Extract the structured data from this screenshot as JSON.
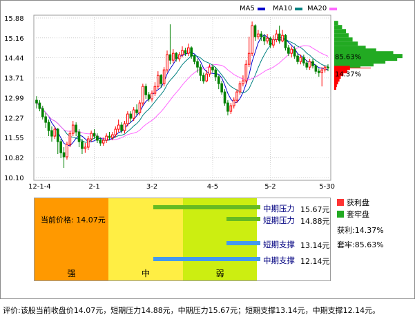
{
  "chart_data": {
    "type": "candlestick",
    "legend": [
      "MA5",
      "MA10",
      "MA20"
    ],
    "colors": {
      "up": "#ff0000",
      "down": "#008000",
      "ma5": "#0000cc",
      "ma10": "#008080",
      "ma20": "#ff66ff",
      "profit": "#ff0000",
      "locked": "#22aa22"
    },
    "y_ticks": [
      "15.88",
      "15.16",
      "14.44",
      "13.71",
      "12.99",
      "12.27",
      "11.55",
      "10.82",
      "10.10"
    ],
    "ylim": [
      10.1,
      15.88
    ],
    "x_ticks": [
      "12-1-4",
      "2-1",
      "3-2",
      "4-5",
      "5-2",
      "5-30"
    ],
    "grid": true,
    "candles": [
      [
        12.9,
        12.8,
        13.05,
        12.6
      ],
      [
        12.8,
        12.6,
        12.9,
        12.5
      ],
      [
        12.6,
        12.3,
        12.7,
        12.2
      ],
      [
        12.3,
        12.1,
        12.45,
        11.9
      ],
      [
        12.1,
        11.8,
        12.2,
        11.6
      ],
      [
        11.8,
        11.6,
        11.95,
        11.4
      ],
      [
        11.6,
        11.85,
        11.95,
        11.5
      ],
      [
        11.85,
        11.4,
        11.9,
        10.95
      ],
      [
        11.4,
        11.0,
        11.5,
        10.8
      ],
      [
        11.0,
        10.85,
        11.2,
        10.45
      ],
      [
        10.85,
        11.3,
        11.4,
        10.75
      ],
      [
        11.3,
        11.7,
        11.8,
        11.2
      ],
      [
        11.7,
        12.0,
        12.15,
        11.6
      ],
      [
        12.0,
        11.75,
        12.1,
        11.6
      ],
      [
        11.75,
        11.4,
        11.85,
        11.2
      ],
      [
        11.4,
        11.15,
        11.5,
        10.95
      ],
      [
        11.15,
        11.2,
        11.35,
        11.0
      ],
      [
        11.2,
        11.5,
        11.6,
        11.1
      ],
      [
        11.5,
        11.7,
        11.8,
        11.4
      ],
      [
        11.7,
        11.6,
        11.85,
        11.5
      ],
      [
        11.6,
        11.45,
        11.7,
        11.35
      ],
      [
        11.45,
        11.35,
        11.55,
        11.25
      ],
      [
        11.35,
        11.45,
        11.55,
        11.25
      ],
      [
        11.45,
        11.6,
        11.7,
        11.35
      ],
      [
        11.6,
        11.55,
        11.75,
        11.45
      ],
      [
        11.55,
        11.65,
        11.75,
        11.45
      ],
      [
        11.65,
        11.85,
        11.95,
        11.55
      ],
      [
        11.85,
        12.0,
        12.2,
        11.75
      ],
      [
        12.0,
        11.8,
        12.1,
        11.7
      ],
      [
        11.8,
        12.05,
        12.15,
        11.7
      ],
      [
        12.05,
        12.4,
        12.5,
        11.95
      ],
      [
        12.4,
        12.25,
        12.5,
        12.1
      ],
      [
        12.25,
        12.55,
        12.65,
        12.15
      ],
      [
        12.55,
        12.45,
        12.75,
        12.35
      ],
      [
        12.45,
        12.8,
        12.9,
        12.35
      ],
      [
        12.8,
        13.4,
        13.5,
        12.7
      ],
      [
        13.4,
        13.1,
        13.5,
        12.95
      ],
      [
        13.1,
        12.95,
        13.2,
        12.85
      ],
      [
        12.95,
        13.15,
        13.25,
        12.85
      ],
      [
        13.15,
        13.4,
        13.55,
        13.05
      ],
      [
        13.4,
        13.8,
        13.95,
        13.3
      ],
      [
        13.8,
        13.5,
        13.85,
        13.35
      ],
      [
        13.5,
        14.0,
        14.1,
        13.4
      ],
      [
        14.0,
        14.55,
        14.7,
        13.9
      ],
      [
        14.55,
        14.35,
        15.65,
        14.2
      ],
      [
        14.35,
        14.6,
        14.75,
        14.25
      ],
      [
        14.6,
        14.4,
        14.65,
        14.3
      ],
      [
        14.4,
        14.55,
        14.65,
        14.3
      ],
      [
        14.55,
        14.7,
        14.85,
        14.45
      ],
      [
        14.7,
        14.6,
        14.8,
        14.5
      ],
      [
        14.6,
        14.8,
        14.95,
        14.5
      ],
      [
        14.8,
        14.5,
        14.85,
        14.4
      ],
      [
        14.5,
        14.3,
        14.55,
        14.2
      ],
      [
        14.3,
        14.1,
        14.4,
        13.9
      ],
      [
        14.1,
        13.8,
        14.2,
        13.6
      ],
      [
        13.8,
        13.6,
        13.9,
        13.5
      ],
      [
        13.6,
        13.85,
        14.0,
        13.55
      ],
      [
        13.85,
        14.1,
        14.2,
        13.75
      ],
      [
        14.1,
        14.0,
        14.2,
        13.9
      ],
      [
        14.0,
        13.75,
        14.1,
        13.6
      ],
      [
        13.75,
        13.5,
        13.8,
        13.3
      ],
      [
        13.5,
        13.2,
        13.6,
        13.1
      ],
      [
        13.2,
        12.8,
        13.3,
        12.7
      ],
      [
        12.8,
        12.5,
        12.9,
        12.35
      ],
      [
        12.5,
        12.7,
        12.8,
        12.4
      ],
      [
        12.7,
        12.9,
        13.0,
        12.6
      ],
      [
        12.9,
        13.2,
        13.3,
        12.8
      ],
      [
        13.2,
        13.5,
        13.6,
        13.1
      ],
      [
        13.5,
        13.6,
        13.8,
        13.4
      ],
      [
        13.6,
        14.2,
        14.35,
        13.5
      ],
      [
        14.2,
        14.6,
        15.2,
        14.1
      ],
      [
        14.6,
        15.6,
        15.75,
        14.5
      ],
      [
        15.6,
        15.2,
        15.65,
        15.05
      ],
      [
        15.2,
        15.3,
        15.45,
        15.1
      ],
      [
        15.3,
        15.2,
        15.4,
        15.05
      ],
      [
        15.2,
        15.05,
        15.3,
        14.9
      ],
      [
        15.05,
        15.15,
        15.3,
        14.95
      ],
      [
        15.15,
        14.9,
        15.2,
        14.8
      ],
      [
        14.9,
        15.1,
        15.25,
        14.8
      ],
      [
        15.1,
        15.3,
        15.45,
        15.0
      ],
      [
        15.3,
        15.05,
        15.6,
        14.95
      ],
      [
        15.05,
        15.25,
        15.45,
        15.0
      ],
      [
        15.25,
        14.8,
        15.3,
        14.7
      ],
      [
        14.8,
        14.6,
        14.9,
        14.5
      ],
      [
        14.6,
        14.75,
        14.85,
        14.45
      ],
      [
        14.75,
        14.5,
        14.85,
        14.4
      ],
      [
        14.5,
        14.3,
        14.6,
        14.2
      ],
      [
        14.3,
        14.45,
        14.55,
        14.2
      ],
      [
        14.45,
        14.25,
        14.55,
        14.15
      ],
      [
        14.25,
        14.1,
        14.35,
        14.0
      ],
      [
        14.1,
        14.3,
        14.4,
        14.0
      ],
      [
        14.3,
        14.15,
        14.4,
        14.05
      ],
      [
        14.15,
        13.95,
        14.2,
        13.85
      ],
      [
        13.95,
        13.9,
        14.05,
        13.75
      ],
      [
        13.9,
        14.0,
        14.1,
        13.4
      ],
      [
        14.0,
        14.1,
        14.15,
        13.9
      ],
      [
        14.1,
        14.07,
        14.2,
        13.95
      ]
    ],
    "distribution": {
      "profit_bars": [
        [
          14.07,
          24
        ],
        [
          13.95,
          20
        ],
        [
          13.85,
          14
        ],
        [
          13.75,
          10
        ],
        [
          13.65,
          8
        ],
        [
          13.55,
          6
        ],
        [
          13.45,
          4
        ],
        [
          13.35,
          3
        ]
      ],
      "locked_bars": [
        [
          15.7,
          6
        ],
        [
          15.55,
          12
        ],
        [
          15.4,
          18
        ],
        [
          15.25,
          22
        ],
        [
          15.1,
          28
        ],
        [
          14.95,
          36
        ],
        [
          14.8,
          48
        ],
        [
          14.7,
          64
        ],
        [
          14.6,
          90
        ],
        [
          14.5,
          104
        ],
        [
          14.4,
          96
        ],
        [
          14.3,
          78
        ],
        [
          14.2,
          60
        ],
        [
          14.15,
          40
        ]
      ],
      "labels": {
        "locked": "85.63%",
        "profit": "14.37%"
      }
    }
  },
  "panel": {
    "price_label": "当前价格: 14.07元",
    "zones": [
      {
        "label": "强",
        "color": "#ff9900"
      },
      {
        "label": "中",
        "color": "#ffee44"
      },
      {
        "label": "弱",
        "color": "#ccee11"
      }
    ],
    "levels": [
      {
        "name": "中期压力",
        "value": "15.67元",
        "color": "#66bb22"
      },
      {
        "name": "短期压力",
        "value": "14.88元",
        "color": "#66bb22"
      },
      {
        "name": "短期支撑",
        "value": "13.14元",
        "color": "#4499ee"
      },
      {
        "name": "中期支撑",
        "value": "12.14元",
        "color": "#4499ee"
      }
    ]
  },
  "side": {
    "profit_label": "获利盘",
    "locked_label": "套牢盘",
    "profit_text": "获利:14.37%",
    "locked_text": "套牢:85.63%"
  },
  "footer": "评价:该股当前收盘价14.07元，短期压力14.88元，中期压力15.67元；短期支撑13.14元，中期支撑12.14元。"
}
